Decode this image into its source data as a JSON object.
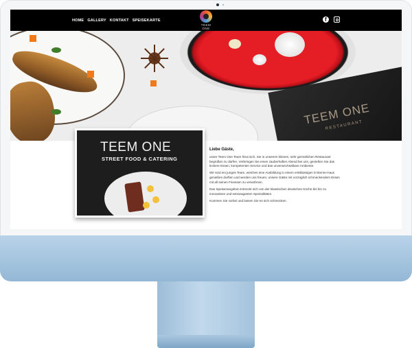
{
  "site": {
    "nav": [
      "HOME",
      "GALLERY",
      "KONTAKT",
      "SPEISEKARTE"
    ],
    "logo_text": "TEEM ONE",
    "social": [
      "facebook-icon",
      "instagram-icon"
    ]
  },
  "hero": {
    "menu_card_title": "TEEM ONE",
    "menu_card_sub": "RESTAURANT"
  },
  "photo": {
    "shirt_title": "TEEM ONE",
    "shirt_sub": "STREET FOOD & CATERING"
  },
  "intro": {
    "heading": "Liebe Gäste,",
    "paragraphs": [
      "unser Teem One Team freut sich, Sie in unserem kleinen, sehr gemütlichen Restaurant begrüßen zu dürfen. Verbringen Sie einen zauberhaften Abend bei uns, genießen Sie das leckere Essen, kompetenten Service und das unverwechselbare Ambiente.",
      "Wir sind ein junges Team, welches eine Ausbildung in einem erstklassigen 5-Sterne-Haus genießen durften und werden uns freuen, unsere Gäste mit vorzüglich schmeckendem Essen mit all seinen Finessen zu verwöhnen.",
      "Das Speisenangebot erstreckt sich von der klassischen deutschen Küche bis hin zu innovativen und extravaganten Spezialitäten.",
      "Kommen Sie vorbei und lassen Sie es sich schmecken."
    ]
  },
  "colors": {
    "nav_bg": "#000000",
    "monitor_blue": "#9dbdd8"
  }
}
